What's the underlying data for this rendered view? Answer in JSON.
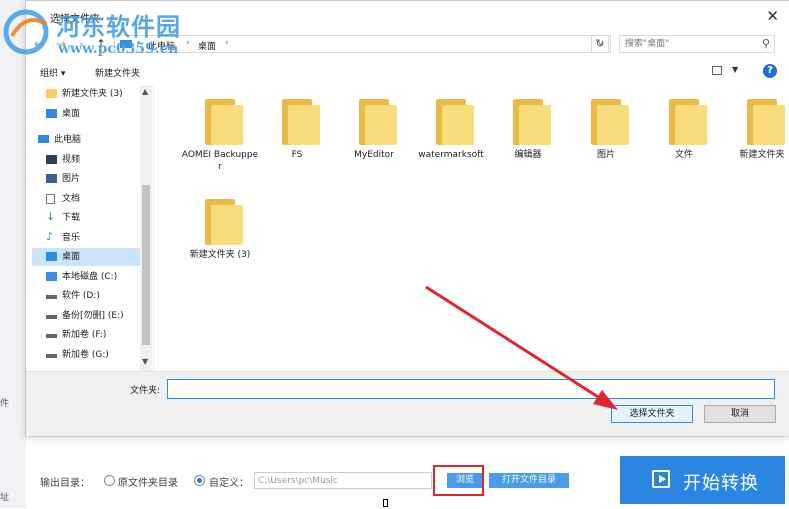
{
  "watermark": {
    "title": "河东软件园",
    "url": "www.pc0359.cn"
  },
  "dialog": {
    "title": "选择文件夹",
    "close_icon": "close-icon",
    "address": {
      "crumbs": [
        "此电脑",
        "桌面"
      ]
    },
    "search_placeholder": "搜索\"桌面\"",
    "toolbar": {
      "organize": "组织 ▾",
      "new_folder": "新建文件夹"
    },
    "nav": [
      {
        "label": "新建文件夹 (3)",
        "icon": "folder"
      },
      {
        "label": "桌面",
        "icon": "desk"
      },
      {
        "label": "此电脑",
        "icon": "pc"
      },
      {
        "label": "视频",
        "icon": "vid"
      },
      {
        "label": "图片",
        "icon": "pic"
      },
      {
        "label": "文档",
        "icon": "doc"
      },
      {
        "label": "下载",
        "icon": "dl"
      },
      {
        "label": "音乐",
        "icon": "music"
      },
      {
        "label": "桌面",
        "icon": "desk",
        "selected": true
      },
      {
        "label": "本地磁盘 (C:)",
        "icon": "win"
      },
      {
        "label": "软件 (D:)",
        "icon": "drive"
      },
      {
        "label": "备份[勿删] (E:)",
        "icon": "drive"
      },
      {
        "label": "新加卷 (F:)",
        "icon": "drive"
      },
      {
        "label": "新加卷 (G:)",
        "icon": "drive"
      }
    ],
    "folders": [
      "AOMEI Backupper",
      "FS",
      "MyEditor",
      "watermarksoft",
      "编辑器",
      "图片",
      "文件",
      "新建文件夹",
      "新建文件夹 (3)"
    ],
    "folder_label": "文件夹:",
    "folder_value": "",
    "select_button": "选择文件夹",
    "cancel_button": "取消"
  },
  "app": {
    "left_stubs": [
      "件",
      "址"
    ],
    "output_label": "输出目录：",
    "radio_original": "原文件夹目录",
    "radio_custom": "自定义：",
    "path_value": "C:\\Users\\pc\\Music",
    "browse_button": "浏览",
    "open_dir_button": "打开文件目录",
    "start_button": "开始转换"
  },
  "colors": {
    "accent": "#2a86e0",
    "highlight": "#e0262a",
    "folder": "#f9dc7c"
  }
}
